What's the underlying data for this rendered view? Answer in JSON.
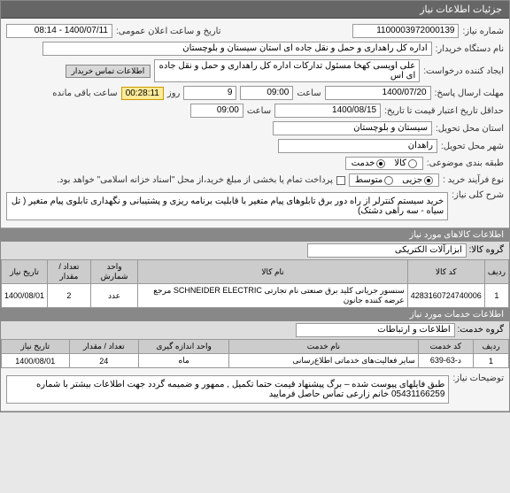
{
  "header": {
    "title": "جزئیات اطلاعات نیاز"
  },
  "fields": {
    "requestNumber": {
      "label": "شماره نیاز:",
      "value": "1100003972000139"
    },
    "publicAnnounce": {
      "label": "تاریخ و ساعت اعلان عمومی:",
      "value": "1400/07/11 - 08:14"
    },
    "buyerOrg": {
      "label": "نام دستگاه خریدار:",
      "value": "اداره کل راهداری و حمل و نقل جاده ای استان سیستان و بلوچستان"
    },
    "requester": {
      "label": "ایجاد کننده درخواست:",
      "value": "علی اویسی کهخا مسئول تدارکات اداره کل راهداری و حمل و نقل جاده ای اس"
    },
    "buyerContact": {
      "button": "اطلاعات تماس خریدار"
    },
    "deadline": {
      "label": "مهلت ارسال پاسخ:",
      "date": "1400/07/20",
      "hourLabel": "ساعت",
      "hour": "09:00",
      "dayLabel": "روز",
      "day": "9"
    },
    "remaining": {
      "label": "ساعت باقی مانده",
      "value": "00:28:11"
    },
    "validity": {
      "label": "حداقل تاریخ اعتبار قیمت تا تاریخ:",
      "date": "1400/08/15",
      "hourLabel": "ساعت",
      "hour": "09:00"
    },
    "province": {
      "label": "استان محل تحویل:",
      "value": "سیستان و بلوچستان"
    },
    "city": {
      "label": "شهر محل تحویل:",
      "value": "راهدان"
    },
    "category": {
      "label": "طبقه بندی موضوعی:",
      "goods": "کالا",
      "service": "خدمت"
    },
    "buyProcess": {
      "label": "نوع فرآیند خرید :",
      "minor": "جزیی",
      "medium": "متوسط",
      "paymentNote": "پرداخت تمام یا بخشی از مبلغ خرید،از محل \"اسناد خزانه اسلامی\" خواهد بود."
    },
    "mainDesc": {
      "label": "شرح کلی نیاز:",
      "value": "خرید سیستم کنترلر از راه دور برق تابلوهای پیام متغیر با قابلیت برنامه ریزی و پشتیبانی و نگهداری تابلوی پیام متغیر ( تل سیاه - سه راهی دشتک)"
    }
  },
  "goodsSection": {
    "header": "اطلاعات کالاهای مورد نیاز",
    "groupLabel": "گروه کالا:",
    "groupValue": "ابزارآلات الکتریکی",
    "columns": [
      "ردیف",
      "کد کالا",
      "نام کالا",
      "واحد شمارش",
      "تعداد / مقدار",
      "تاریخ نیاز"
    ],
    "rows": [
      {
        "idx": "1",
        "code": "4283160724740006",
        "name": "سنسور جریانی کلید برق صنعتی نام تجارتی SCHNEIDER ELECTRIC مرجع عرضه کننده جانون",
        "unit": "عدد",
        "qty": "2",
        "date": "1400/08/01"
      }
    ]
  },
  "servicesSection": {
    "header": "اطلاعات خدمات مورد نیاز",
    "groupLabel": "گروه خدمت:",
    "groupValue": "اطلاعات و ارتباطات",
    "columns": [
      "ردیف",
      "کد خدمت",
      "نام خدمت",
      "واحد اندازه گیری",
      "تعداد / مقدار",
      "تاریخ نیاز"
    ],
    "rows": [
      {
        "idx": "1",
        "code": "د-63-639",
        "name": "سایر فعالیت‌های خدماتی اطلاع‌رسانی",
        "unit": "ماه",
        "qty": "24",
        "date": "1400/08/01"
      }
    ]
  },
  "notes": {
    "label": "توضیحات نیاز:",
    "value": "طبق فایلهای پیوست شده – برگ پیشنهاد قیمت حتما تکمیل , ممهور و ضمیمه گردد جهت اطلاعات بیشتر با شماره 05431166259 خانم زارعی تماس حاصل فرمایید"
  }
}
